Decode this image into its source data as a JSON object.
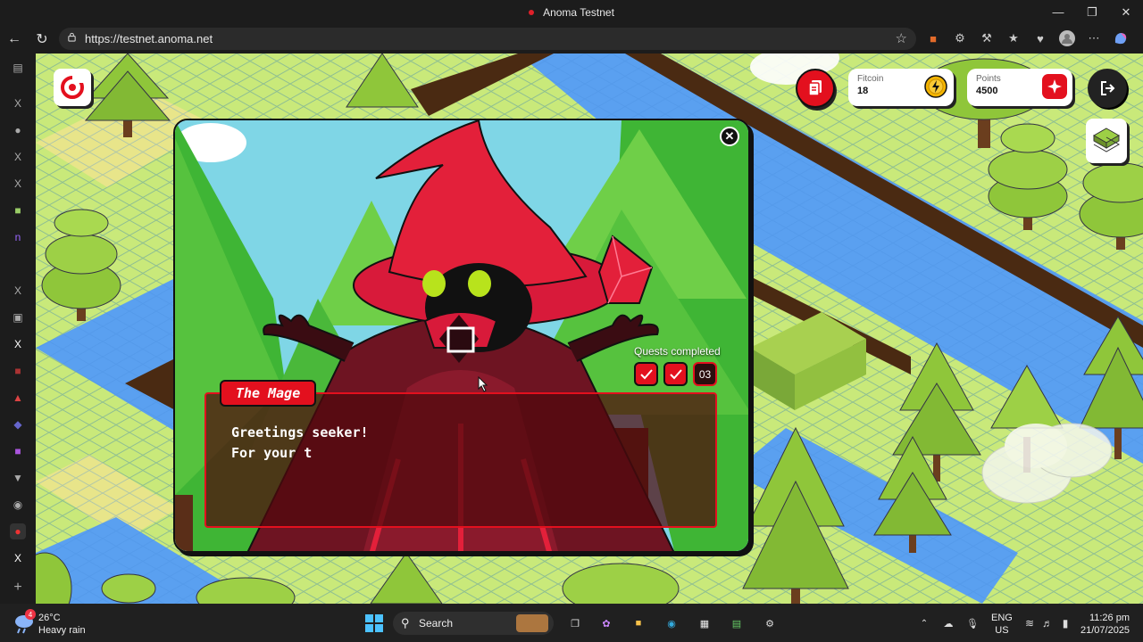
{
  "window": {
    "title": "Anoma Testnet"
  },
  "browser": {
    "url": "https://testnet.anoma.net"
  },
  "hud": {
    "fitcoin": {
      "label": "Fitcoin",
      "value": "18"
    },
    "points": {
      "label": "Points",
      "value": "4500"
    }
  },
  "modal": {
    "speaker": "The Mage",
    "dialog_text": "Greetings seeker!\nFor your t",
    "quests_label": "Quests completed",
    "quests_current": "03"
  },
  "taskbar": {
    "weather_temp": "26°C",
    "weather_desc": "Heavy rain",
    "weather_badge": "4",
    "search_label": "Search",
    "lang_1": "ENG",
    "lang_2": "US",
    "time": "11:26 pm",
    "date": "21/07/2025"
  },
  "colors": {
    "accent_red": "#e3101e",
    "grass": "#c9e97a",
    "water": "#5aa0f0",
    "tree_green": "#8fc63a"
  }
}
